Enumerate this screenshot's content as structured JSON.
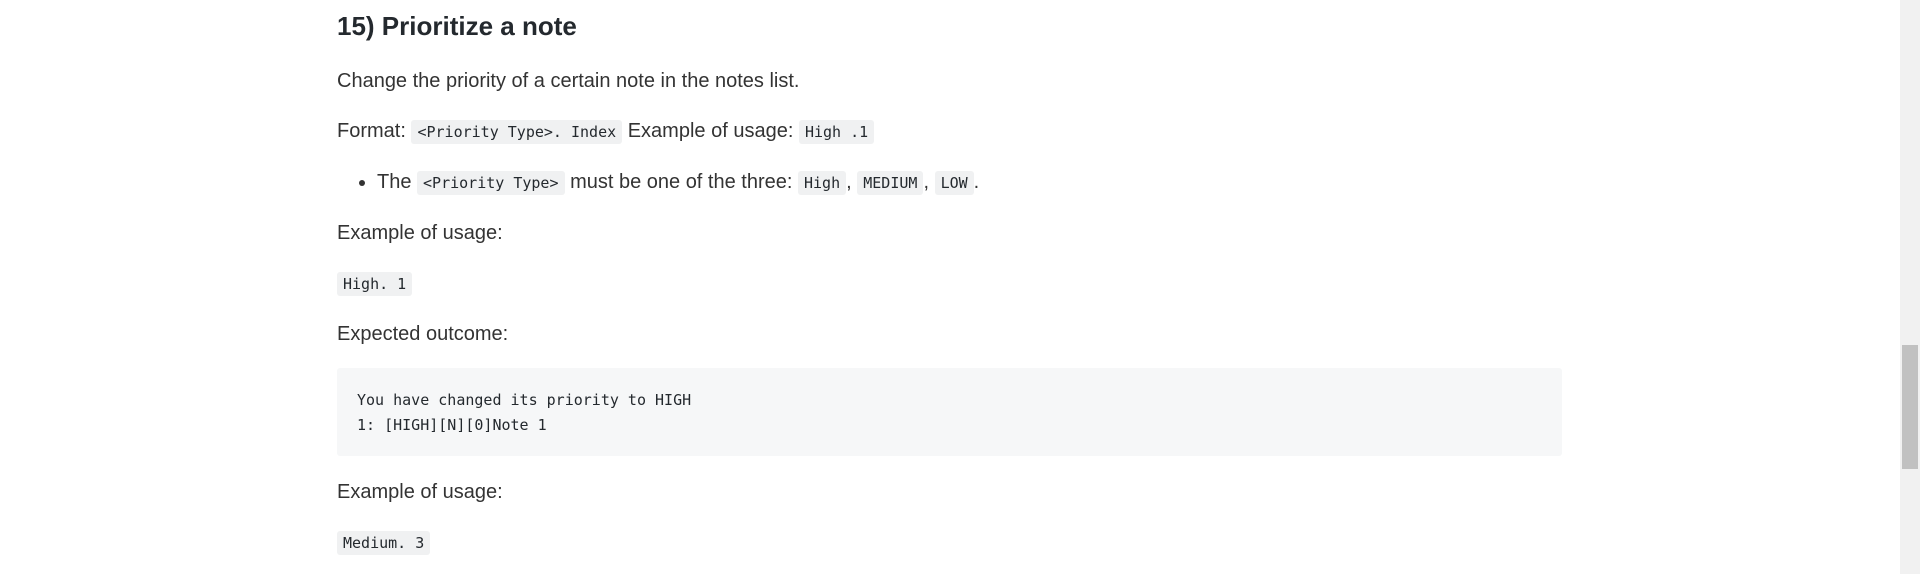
{
  "section": {
    "title": "15) Prioritize a note",
    "description": "Change the priority of a certain note in the notes list.",
    "format_label": "Format:",
    "format_code": "<Priority Type>. Index",
    "format_example_label": "Example of usage:",
    "format_example_code": "High .1",
    "bullet": {
      "prefix": "The",
      "code": "<Priority Type>",
      "middle": "must be one of the three:",
      "options": [
        "High",
        "MEDIUM",
        "LOW"
      ],
      "sep": ",",
      "end": "."
    },
    "example1_label": "Example of usage:",
    "example1_code": "High. 1",
    "outcome_label": "Expected outcome:",
    "outcome_lines": [
      "You have changed its priority to HIGH",
      "1: [HIGH][N][0]Note 1"
    ],
    "example2_label": "Example of usage:",
    "example2_code": "Medium. 3"
  },
  "colors": {
    "code_bg": "#f0f1f2",
    "pre_bg": "#f6f7f8",
    "scrollbar_thumb": "#c1c1c1"
  }
}
